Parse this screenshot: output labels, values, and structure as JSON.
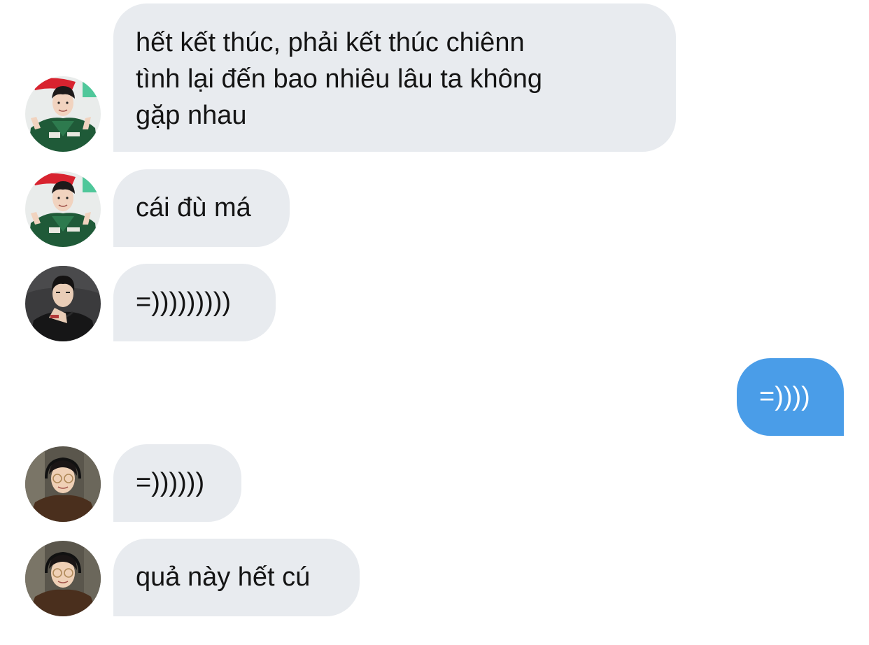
{
  "colors": {
    "incoming_bubble": "#e8ebef",
    "outgoing_bubble": "#4a9de8",
    "incoming_text": "#141414",
    "outgoing_text": "#ffffff"
  },
  "messages": [
    {
      "direction": "incoming",
      "sender_avatar": "avatar-green-jacket",
      "lines": [
        "hết kết thúc, phải kết thúc chiênn",
        "tình lại đến bao nhiêu lâu ta không",
        "gặp nhau"
      ]
    },
    {
      "direction": "incoming",
      "sender_avatar": "avatar-green-jacket",
      "lines": [
        "cái đù má"
      ]
    },
    {
      "direction": "incoming",
      "sender_avatar": "avatar-black-hoodie",
      "lines": [
        "=)))))))))"
      ]
    },
    {
      "direction": "outgoing",
      "lines": [
        "=))))"
      ]
    },
    {
      "direction": "incoming",
      "sender_avatar": "avatar-glasses-headphones",
      "lines": [
        "=))))))"
      ]
    },
    {
      "direction": "incoming",
      "sender_avatar": "avatar-glasses-headphones",
      "lines": [
        "quả này hết cú"
      ]
    }
  ]
}
